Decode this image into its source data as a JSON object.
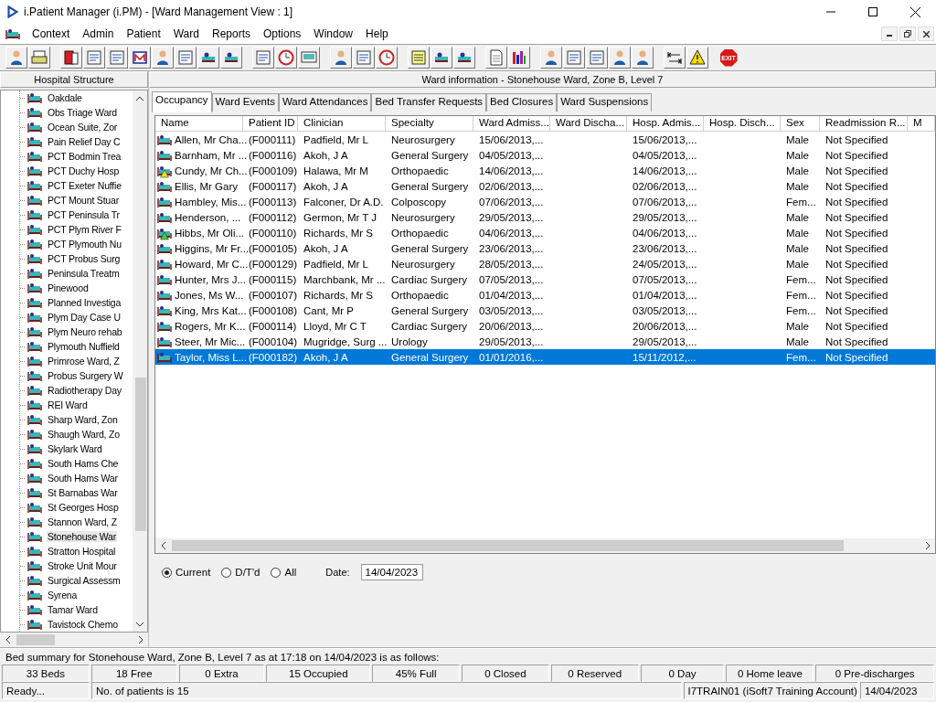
{
  "window": {
    "title": "i.Patient Manager (i.PM) - [Ward Management View : 1]"
  },
  "menu": [
    "Context",
    "Admin",
    "Patient",
    "Ward",
    "Reports",
    "Options",
    "Window",
    "Help"
  ],
  "toolbar": {
    "exit_label": "EXIT"
  },
  "sidebar": {
    "title": "Hospital Structure",
    "items": [
      {
        "label": "Oakdale",
        "selected": false
      },
      {
        "label": "Obs Triage Ward",
        "selected": false
      },
      {
        "label": "Ocean Suite, Zor",
        "selected": false
      },
      {
        "label": "Pain Relief Day C",
        "selected": false
      },
      {
        "label": "PCT Bodmin Trea",
        "selected": false
      },
      {
        "label": "PCT Duchy Hosp",
        "selected": false
      },
      {
        "label": "PCT Exeter Nuffie",
        "selected": false
      },
      {
        "label": "PCT Mount Stuar",
        "selected": false
      },
      {
        "label": "PCT Peninsula Tr",
        "selected": false
      },
      {
        "label": "PCT Plym River F",
        "selected": false
      },
      {
        "label": "PCT Plymouth Nu",
        "selected": false
      },
      {
        "label": "PCT Probus Surg",
        "selected": false
      },
      {
        "label": "Peninsula Treatm",
        "selected": false
      },
      {
        "label": "Pinewood",
        "selected": false
      },
      {
        "label": "Planned Investiga",
        "selected": false
      },
      {
        "label": "Plym Day Case U",
        "selected": false
      },
      {
        "label": "Plym Neuro rehab",
        "selected": false
      },
      {
        "label": "Plymouth Nuffield",
        "selected": false
      },
      {
        "label": "Primrose Ward, Z",
        "selected": false
      },
      {
        "label": "Probus Surgery W",
        "selected": false
      },
      {
        "label": "Radiotherapy Day",
        "selected": false
      },
      {
        "label": "REI Ward",
        "selected": false
      },
      {
        "label": "Sharp Ward, Zon",
        "selected": false
      },
      {
        "label": "Shaugh Ward, Zo",
        "selected": false
      },
      {
        "label": "Skylark Ward",
        "selected": false
      },
      {
        "label": "South Hams Che",
        "selected": false
      },
      {
        "label": "South Hams War",
        "selected": false
      },
      {
        "label": "St Barnabas War",
        "selected": false
      },
      {
        "label": "St Georges Hosp",
        "selected": false
      },
      {
        "label": "Stannon Ward, Z",
        "selected": false
      },
      {
        "label": "Stonehouse War",
        "selected": true
      },
      {
        "label": "Stratton Hospital",
        "selected": false
      },
      {
        "label": "Stroke Unit Mour",
        "selected": false
      },
      {
        "label": "Surgical Assessm",
        "selected": false
      },
      {
        "label": "Syrena",
        "selected": false
      },
      {
        "label": "Tamar Ward",
        "selected": false
      },
      {
        "label": "Tavistock Chemo",
        "selected": false
      }
    ]
  },
  "ward_info": "Ward information - Stonehouse Ward, Zone B, Level 7",
  "tabs": [
    {
      "label": "Occupancy",
      "selected": true
    },
    {
      "label": "Ward Events",
      "selected": false
    },
    {
      "label": "Ward Attendances",
      "selected": false
    },
    {
      "label": "Bed Transfer Requests",
      "selected": false
    },
    {
      "label": "Bed Closures",
      "selected": false
    },
    {
      "label": "Ward Suspensions",
      "selected": false
    }
  ],
  "table": {
    "columns": [
      "Name",
      "Patient ID",
      "Clinician",
      "Specialty",
      "Ward Admiss...",
      "Ward Discha...",
      "Hosp. Admis...",
      "Hosp. Disch...",
      "Sex",
      "Readmission R...",
      "M"
    ],
    "rows": [
      {
        "kind": "plain",
        "selected": false,
        "cells": [
          "Allen, Mr Cha...",
          "(F000111)",
          "Padfield, Mr L",
          "Neurosurgery",
          "15/06/2013,...",
          "",
          "15/06/2013,...",
          "",
          "Male",
          "Not Specified"
        ]
      },
      {
        "kind": "plain",
        "selected": false,
        "cells": [
          "Barnham, Mr ...",
          "(F000116)",
          "Akoh, J A",
          "General Surgery",
          "04/05/2013,...",
          "",
          "04/05/2013,...",
          "",
          "Male",
          "Not Specified"
        ]
      },
      {
        "kind": "warning",
        "color": "#f0e020",
        "selected": false,
        "cells": [
          "Cundy, Mr Ch...",
          "(F000109)",
          "Halawa, Mr M",
          "Orthopaedic",
          "14/06/2013,...",
          "",
          "14/06/2013,...",
          "",
          "Male",
          "Not Specified"
        ]
      },
      {
        "kind": "plain",
        "selected": false,
        "cells": [
          "Ellis, Mr Gary",
          "(F000117)",
          "Akoh, J A",
          "General Surgery",
          "02/06/2013,...",
          "",
          "02/06/2013,...",
          "",
          "Male",
          "Not Specified"
        ]
      },
      {
        "kind": "plain",
        "selected": false,
        "cells": [
          "Hambley, Mis...",
          "(F000113)",
          "Falconer, Dr A.D.",
          "Colposcopy",
          "07/06/2013,...",
          "",
          "07/06/2013,...",
          "",
          "Fem...",
          "Not Specified"
        ]
      },
      {
        "kind": "plain",
        "selected": false,
        "cells": [
          "Henderson, ...",
          "(F000112)",
          "Germon, Mr T J",
          "Neurosurgery",
          "29/05/2013,...",
          "",
          "29/05/2013,...",
          "",
          "Male",
          "Not Specified"
        ]
      },
      {
        "kind": "warning",
        "color": "#40d040",
        "selected": false,
        "cells": [
          "Hibbs, Mr Oli...",
          "(F000110)",
          "Richards, Mr S",
          "Orthopaedic",
          "04/06/2013,...",
          "",
          "04/06/2013,...",
          "",
          "Male",
          "Not Specified"
        ]
      },
      {
        "kind": "plain",
        "selected": false,
        "cells": [
          "Higgins, Mr Fr...",
          "(F000105)",
          "Akoh, J A",
          "General Surgery",
          "23/06/2013,...",
          "",
          "23/06/2013,...",
          "",
          "Male",
          "Not Specified"
        ]
      },
      {
        "kind": "plain",
        "selected": false,
        "cells": [
          "Howard, Mr C...",
          "(F000129)",
          "Padfield, Mr L",
          "Neurosurgery",
          "28/05/2013,...",
          "",
          "24/05/2013,...",
          "",
          "Male",
          "Not Specified"
        ]
      },
      {
        "kind": "plain",
        "selected": false,
        "cells": [
          "Hunter, Mrs J...",
          "(F000115)",
          "Marchbank, Mr ...",
          "Cardiac Surgery",
          "07/05/2013,...",
          "",
          "07/05/2013,...",
          "",
          "Fem...",
          "Not Specified"
        ]
      },
      {
        "kind": "plain",
        "selected": false,
        "cells": [
          "Jones, Ms W...",
          "(F000107)",
          "Richards, Mr S",
          "Orthopaedic",
          "01/04/2013,...",
          "",
          "01/04/2013,...",
          "",
          "Fem...",
          "Not Specified"
        ]
      },
      {
        "kind": "plain",
        "selected": false,
        "cells": [
          "King, Mrs Kat...",
          "(F000108)",
          "Cant, Mr P",
          "General Surgery",
          "03/05/2013,...",
          "",
          "03/05/2013,...",
          "",
          "Fem...",
          "Not Specified"
        ]
      },
      {
        "kind": "plain",
        "selected": false,
        "cells": [
          "Rogers, Mr K...",
          "(F000114)",
          "Lloyd, Mr C T",
          "Cardiac Surgery",
          "20/06/2013,...",
          "",
          "20/06/2013,...",
          "",
          "Male",
          "Not Specified"
        ]
      },
      {
        "kind": "plain",
        "selected": false,
        "cells": [
          "Steer, Mr Mic...",
          "(F000104)",
          "Mugridge, Surg ...",
          "Urology",
          "29/05/2013,...",
          "",
          "29/05/2013,...",
          "",
          "Male",
          "Not Specified"
        ]
      },
      {
        "kind": "plain",
        "selected": true,
        "cells": [
          "Taylor, Miss L...",
          "(F000182)",
          "Akoh, J A",
          "General Surgery",
          "01/01/2016,...",
          "",
          "15/11/2012,...",
          "",
          "Fem...",
          "Not Specified"
        ]
      }
    ]
  },
  "filter": {
    "options": [
      {
        "label": "Current",
        "selected": true
      },
      {
        "label": "D/T'd",
        "selected": false
      },
      {
        "label": "All",
        "selected": false
      }
    ],
    "date_label": "Date:",
    "date_value": "14/04/2023"
  },
  "bed_summary": "Bed summary for Stonehouse Ward, Zone B, Level 7 as at 17:18 on 14/04/2023 is as follows:",
  "stats": [
    "33 Beds",
    "18 Free",
    "0 Extra",
    "15 Occupied",
    "45% Full",
    "0 Closed",
    "0 Reserved",
    "0 Day",
    "0 Home leave",
    "0 Pre-discharges"
  ],
  "status_bar": [
    "Ready...",
    "No. of patients is 15",
    "I7TRAIN01 (iSoft7 Training Account)",
    "14/04/2023"
  ]
}
